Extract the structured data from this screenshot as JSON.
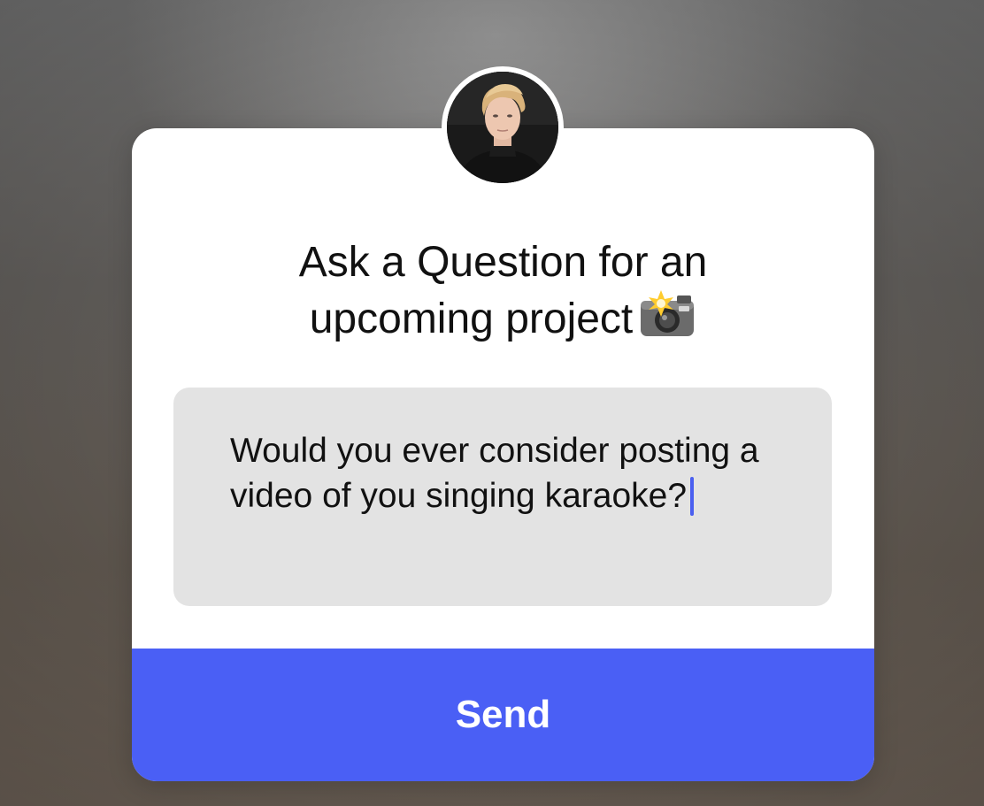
{
  "prompt": {
    "title_line1": "Ask a Question for an",
    "title_line2": "upcoming project",
    "title_emoji": "📸",
    "input_value": "Would you ever consider posting a video of you singing karaoke?",
    "send_label": "Send"
  },
  "avatar": {
    "icon": "profile-photo"
  },
  "colors": {
    "accent": "#4a5ff5",
    "caret": "#4a5ff0",
    "input_bg": "#e3e3e3",
    "card_bg": "#ffffff"
  }
}
